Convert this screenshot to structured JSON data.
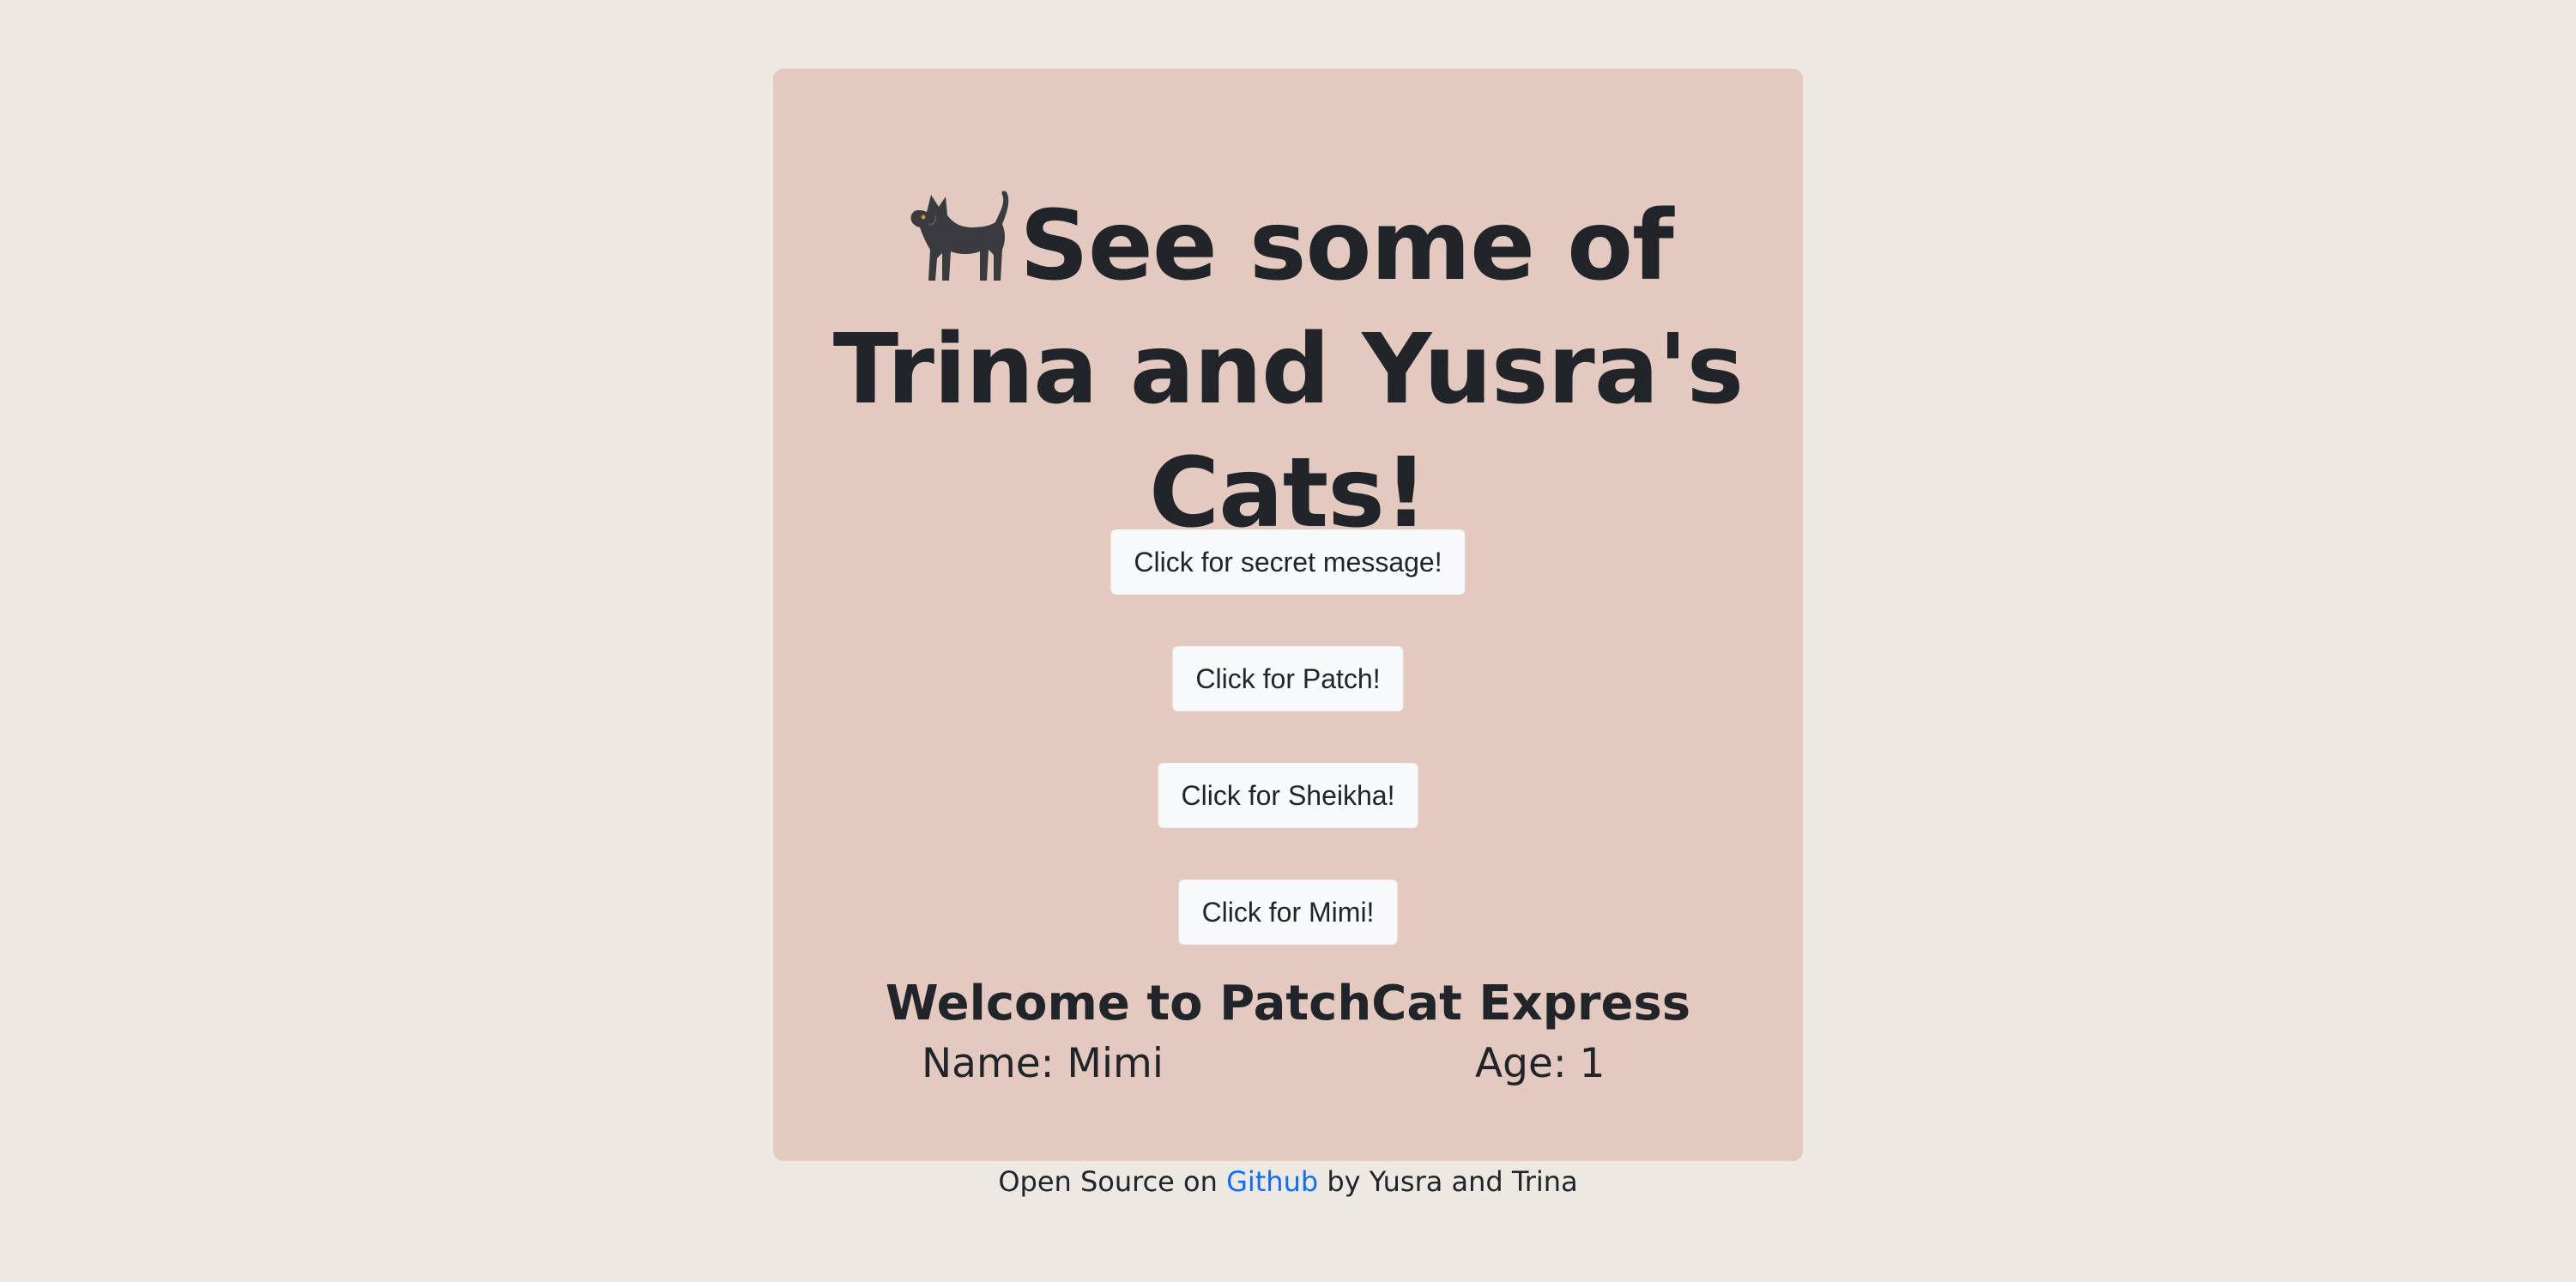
{
  "header": {
    "title": "See some of Trina and Yusra's Cats!"
  },
  "buttons": {
    "secret_label": "Click for secret message!",
    "patch_label": "Click for Patch!",
    "sheikha_label": "Click for Sheikha!",
    "mimi_label": "Click for Mimi!"
  },
  "cat_info": {
    "welcome": "Welcome to PatchCat Express",
    "name": "Name: Mimi",
    "age": "Age: 1"
  },
  "footer": {
    "prefix": "Open Source on ",
    "link_label": "Github",
    "suffix": " by Yusra and Trina"
  },
  "icons": {
    "title_icon": "cat-icon"
  },
  "colors": {
    "page_background": "#eee8e3",
    "card_background": "#e3c9bf",
    "text": "#212529",
    "link": "#0d6efd",
    "button_background": "#f8f9fa"
  }
}
